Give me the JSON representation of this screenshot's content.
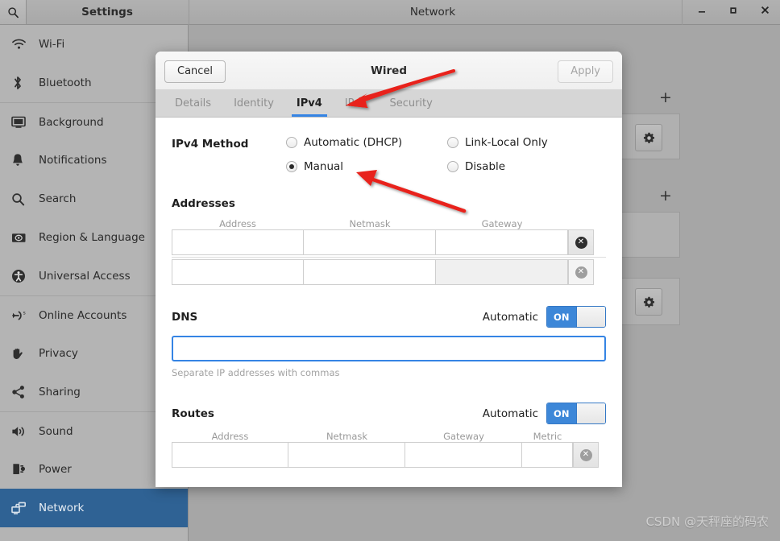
{
  "window": {
    "app_title": "Settings",
    "title": "Network",
    "search_icon": "search-icon",
    "controls": {
      "minimize": "–",
      "maximize": "□",
      "close": "✕"
    }
  },
  "sidebar": {
    "items": [
      {
        "label": "Wi-Fi",
        "icon": "wifi-icon",
        "selected": false,
        "separator_above": false
      },
      {
        "label": "Bluetooth",
        "icon": "bluetooth-icon",
        "selected": false,
        "separator_above": false
      },
      {
        "label": "Background",
        "icon": "background-icon",
        "selected": false,
        "separator_above": true
      },
      {
        "label": "Notifications",
        "icon": "bell-icon",
        "selected": false,
        "separator_above": false
      },
      {
        "label": "Search",
        "icon": "search-icon",
        "selected": false,
        "separator_above": false
      },
      {
        "label": "Region & Language",
        "icon": "region-language-icon",
        "selected": false,
        "separator_above": false
      },
      {
        "label": "Universal Access",
        "icon": "universal-access-icon",
        "selected": false,
        "separator_above": false
      },
      {
        "label": "Online Accounts",
        "icon": "online-accounts-icon",
        "selected": false,
        "separator_above": true
      },
      {
        "label": "Privacy",
        "icon": "hand-icon",
        "selected": false,
        "separator_above": false
      },
      {
        "label": "Sharing",
        "icon": "share-icon",
        "selected": false,
        "separator_above": false
      },
      {
        "label": "Sound",
        "icon": "speaker-icon",
        "selected": false,
        "separator_above": true
      },
      {
        "label": "Power",
        "icon": "power-plug-icon",
        "selected": false,
        "separator_above": false
      },
      {
        "label": "Network",
        "icon": "network-icon",
        "selected": true,
        "separator_above": false
      }
    ]
  },
  "background_panel": {
    "add_button_label": "+",
    "gear_icon": "gear-icon"
  },
  "dialog": {
    "title": "Wired",
    "cancel_label": "Cancel",
    "apply_label": "Apply",
    "tabs": [
      {
        "label": "Details",
        "active": false
      },
      {
        "label": "Identity",
        "active": false
      },
      {
        "label": "IPv4",
        "active": true
      },
      {
        "label": "IPv6",
        "active": false
      },
      {
        "label": "Security",
        "active": false
      }
    ],
    "method": {
      "label": "IPv4 Method",
      "options": [
        {
          "label": "Automatic (DHCP)",
          "checked": false
        },
        {
          "label": "Link-Local Only",
          "checked": false
        },
        {
          "label": "Manual",
          "checked": true
        },
        {
          "label": "Disable",
          "checked": false
        }
      ]
    },
    "addresses": {
      "title": "Addresses",
      "columns": [
        "Address",
        "Netmask",
        "Gateway"
      ],
      "rows": [
        {
          "address": "",
          "netmask": "",
          "gateway": "",
          "gateway_disabled": false,
          "delete_icon": "delete-icon"
        },
        {
          "address": "",
          "netmask": "",
          "gateway": "",
          "gateway_disabled": true,
          "delete_icon": "delete-icon"
        }
      ]
    },
    "dns": {
      "title": "DNS",
      "automatic_label": "Automatic",
      "switch_state": "ON",
      "value": "",
      "hint": "Separate IP addresses with commas"
    },
    "routes": {
      "title": "Routes",
      "automatic_label": "Automatic",
      "switch_state": "ON",
      "columns": [
        "Address",
        "Netmask",
        "Gateway",
        "Metric"
      ],
      "rows": [
        {
          "address": "",
          "netmask": "",
          "gateway": "",
          "metric": "",
          "delete_icon": "delete-icon"
        }
      ]
    }
  },
  "annotations": {
    "arrow_color": "#e8231a",
    "arrows": [
      {
        "name": "arrow-to-ipv4-tab",
        "points": "from (560,88) to (424,130)"
      },
      {
        "name": "arrow-to-manual-radio",
        "points": "from (575,262) to (438,215)"
      }
    ]
  },
  "watermark": {
    "text": "CSDN @天秤座的码农"
  }
}
